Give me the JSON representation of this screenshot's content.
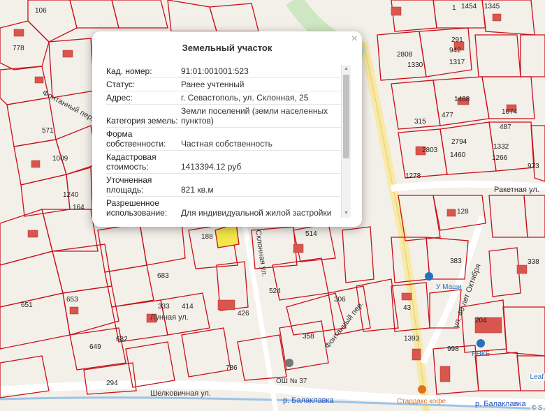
{
  "popup": {
    "title": "Земельный участок",
    "close_symbol": "×",
    "fields": [
      {
        "key": "Кад. номер:",
        "value": "91:01:001001:523"
      },
      {
        "key": "Статус:",
        "value": "Ранее учтенный"
      },
      {
        "key": "Адрес:",
        "value": "г. Севастополь, ул. Склонная, 25"
      },
      {
        "key": "Категория земель:",
        "value": "Земли поселений (земли населенных пунктов)"
      },
      {
        "key": "Форма собственности:",
        "value": "Частная собственность"
      },
      {
        "key": "Кадастровая стоимость:",
        "value": "1413394.12 руб"
      },
      {
        "key": "Уточненная площадь:",
        "value": "821 кв.м"
      },
      {
        "key": "Разрешенное использование:",
        "value": "Для индивидуальной жилой застройки"
      }
    ]
  },
  "map": {
    "streets": [
      {
        "text": "Ракетная ул."
      },
      {
        "text": "ул. 40 лет Октября"
      },
      {
        "text": "Склонная ул."
      },
      {
        "text": "Фонтанный пер."
      },
      {
        "text": "Шелковичная ул."
      },
      {
        "text": "Лунная ул."
      },
      {
        "text": "Фонтанный пер."
      }
    ],
    "rivers": [
      {
        "text": "р. Балаклавка"
      },
      {
        "text": "р. Балаклавка"
      }
    ],
    "pois": [
      {
        "text": "У Маши",
        "color": "#2a6fbb"
      },
      {
        "text": "РНКБ",
        "color": "#2a6fbb"
      },
      {
        "text": "Стардакс кофе",
        "color": "#e07020"
      },
      {
        "text": "ОШ № 37",
        "color": "#333333"
      }
    ],
    "attribution": "© S",
    "leaflet_label": "Leaf"
  }
}
